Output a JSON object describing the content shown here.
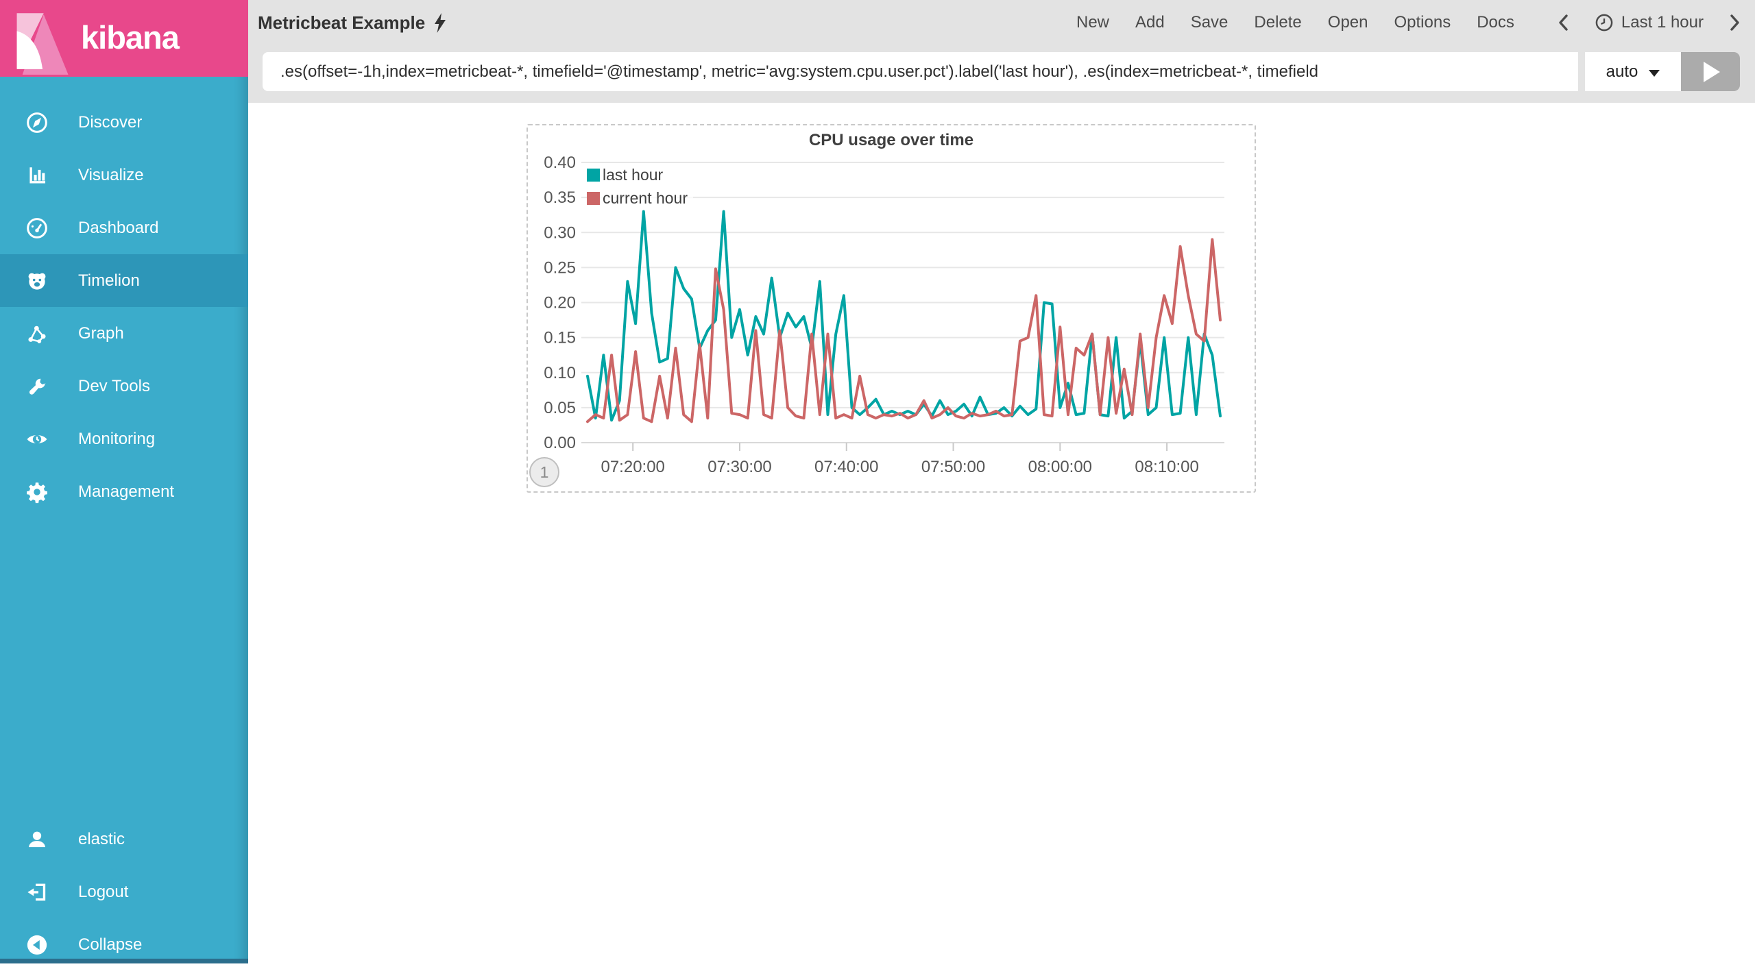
{
  "branding": {
    "app_name": "kibana",
    "logo_bg": "#E8488B"
  },
  "sidebar": {
    "bg": "#3BACCB",
    "selected_bg": "#2D96B8",
    "selected": "Timelion",
    "items": [
      {
        "label": "Discover",
        "icon": "compass"
      },
      {
        "label": "Visualize",
        "icon": "bar-chart"
      },
      {
        "label": "Dashboard",
        "icon": "gauge"
      },
      {
        "label": "Timelion",
        "icon": "bear"
      },
      {
        "label": "Graph",
        "icon": "network"
      },
      {
        "label": "Dev Tools",
        "icon": "wrench"
      },
      {
        "label": "Monitoring",
        "icon": "eye"
      },
      {
        "label": "Management",
        "icon": "gear"
      }
    ],
    "footer_items": [
      {
        "label": "elastic",
        "icon": "user"
      },
      {
        "label": "Logout",
        "icon": "logout"
      },
      {
        "label": "Collapse",
        "icon": "collapse-circle"
      }
    ]
  },
  "topbar": {
    "title": "Metricbeat Example",
    "title_icon": "lightning-bolt",
    "menu": [
      "New",
      "Add",
      "Save",
      "Delete",
      "Open",
      "Options",
      "Docs"
    ],
    "time_picker": {
      "label": "Last 1 hour",
      "icon": "clock"
    }
  },
  "query_bar": {
    "expression": ".es(offset=-1h,index=metricbeat-*, timefield='@timestamp', metric='avg:system.cpu.user.pct').label('last hour'), .es(index=metricbeat-*, timefield",
    "interval_value": "auto"
  },
  "panel": {
    "page_badge": "1"
  },
  "chart_data": {
    "type": "line",
    "title": "CPU usage over time",
    "xlabel": "",
    "ylabel": "",
    "ylim": [
      0,
      0.4
    ],
    "y_ticks": [
      0,
      0.05,
      0.1,
      0.15,
      0.2,
      0.25,
      0.3,
      0.35,
      0.4
    ],
    "grid": true,
    "legend_position": "top-left",
    "x_unit": "minutes after 07:00",
    "t_domain": [
      15.75,
      75
    ],
    "x_ticks": [
      {
        "t": 20,
        "label": "07:20:00"
      },
      {
        "t": 30,
        "label": "07:30:00"
      },
      {
        "t": 40,
        "label": "07:40:00"
      },
      {
        "t": 50,
        "label": "07:50:00"
      },
      {
        "t": 60,
        "label": "08:00:00"
      },
      {
        "t": 70,
        "label": "08:10:00"
      }
    ],
    "series": [
      {
        "name": "last hour",
        "color": "#01A4A4",
        "t_start": 15.75,
        "t_step": 0.75,
        "values": [
          0.095,
          0.035,
          0.125,
          0.032,
          0.06,
          0.23,
          0.17,
          0.33,
          0.185,
          0.115,
          0.12,
          0.25,
          0.22,
          0.205,
          0.135,
          0.16,
          0.175,
          0.33,
          0.15,
          0.19,
          0.125,
          0.18,
          0.155,
          0.235,
          0.15,
          0.185,
          0.165,
          0.18,
          0.135,
          0.23,
          0.04,
          0.155,
          0.21,
          0.05,
          0.04,
          0.05,
          0.062,
          0.04,
          0.045,
          0.04,
          0.045,
          0.04,
          0.055,
          0.038,
          0.06,
          0.04,
          0.045,
          0.055,
          0.038,
          0.065,
          0.04,
          0.042,
          0.05,
          0.038,
          0.052,
          0.04,
          0.048,
          0.2,
          0.198,
          0.05,
          0.085,
          0.04,
          0.042,
          0.155,
          0.04,
          0.038,
          0.15,
          0.035,
          0.045,
          0.145,
          0.04,
          0.05,
          0.15,
          0.04,
          0.042,
          0.15,
          0.04,
          0.155,
          0.125,
          0.038
        ]
      },
      {
        "name": "current hour",
        "color": "#CC6666",
        "t_start": 15.75,
        "t_step": 0.75,
        "values": [
          0.03,
          0.04,
          0.035,
          0.125,
          0.032,
          0.04,
          0.13,
          0.035,
          0.03,
          0.095,
          0.035,
          0.135,
          0.04,
          0.03,
          0.14,
          0.035,
          0.248,
          0.19,
          0.042,
          0.04,
          0.035,
          0.16,
          0.04,
          0.035,
          0.16,
          0.05,
          0.038,
          0.035,
          0.155,
          0.04,
          0.155,
          0.035,
          0.04,
          0.035,
          0.095,
          0.04,
          0.035,
          0.04,
          0.038,
          0.042,
          0.035,
          0.04,
          0.06,
          0.035,
          0.04,
          0.05,
          0.038,
          0.035,
          0.042,
          0.038,
          0.04,
          0.045,
          0.038,
          0.04,
          0.145,
          0.15,
          0.21,
          0.04,
          0.038,
          0.165,
          0.04,
          0.135,
          0.125,
          0.155,
          0.04,
          0.15,
          0.042,
          0.105,
          0.04,
          0.155,
          0.05,
          0.15,
          0.21,
          0.17,
          0.28,
          0.21,
          0.155,
          0.145,
          0.29,
          0.175
        ]
      }
    ]
  }
}
